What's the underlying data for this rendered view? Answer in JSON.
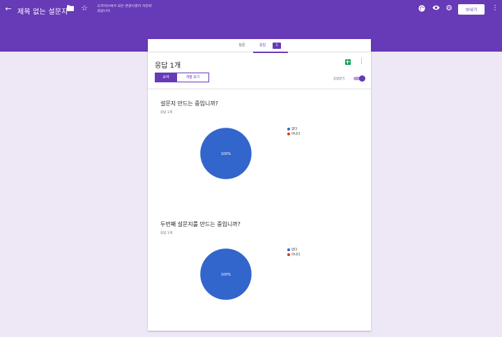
{
  "header": {
    "title": "제목 없는 설문지",
    "save_note": "드라이브에서 모든 변경사항이 저장되었습니다.",
    "send_label": "보내기",
    "icons": {
      "back": "arrow-back-icon",
      "folder": "folder-icon",
      "star": "star-icon",
      "palette": "palette-icon",
      "preview": "eye-icon",
      "settings": "gear-icon",
      "more": "more-vert-icon"
    },
    "background": "#673ab7"
  },
  "tabs": [
    {
      "label": "질문",
      "active": false
    },
    {
      "label": "응답",
      "active": true,
      "badge": "1"
    }
  ],
  "responses": {
    "title": "응답 1개",
    "views": [
      {
        "label": "요약",
        "selected": true
      },
      {
        "label": "개별 보기",
        "selected": false
      }
    ],
    "accepting_label": "응답받기",
    "accepting": true
  },
  "colors": {
    "accent": "#673ab7",
    "pie_yes": "#3366cc",
    "pie_no": "#dc3912",
    "sheets": "#0f9d58"
  },
  "questions": [
    {
      "title": "설문지 만드는 중입니까?",
      "count_label": "응답 1개",
      "pie_label": "100%",
      "legend": [
        {
          "label": "맞다",
          "color": "#3366cc"
        },
        {
          "label": "아니다",
          "color": "#dc3912"
        }
      ],
      "values": [
        1,
        0
      ]
    },
    {
      "title": "두번째 설문지를 만드는 중입니까?",
      "count_label": "응답 1개",
      "pie_label": "100%",
      "legend": [
        {
          "label": "맞다",
          "color": "#3366cc"
        },
        {
          "label": "아니다",
          "color": "#dc3912"
        }
      ],
      "values": [
        1,
        0
      ]
    }
  ]
}
